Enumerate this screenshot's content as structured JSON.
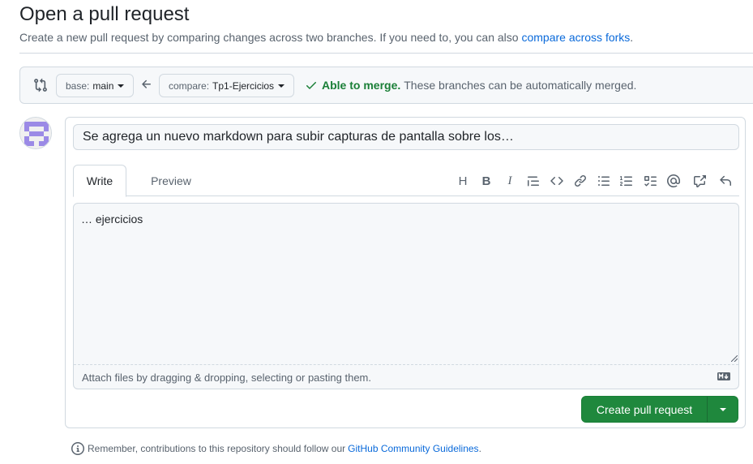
{
  "header": {
    "title": "Open a pull request",
    "subtitle_text": "Create a new pull request by comparing changes across two branches. If you need to, you can also",
    "subtitle_link": "compare across forks",
    "subtitle_end": "."
  },
  "compare": {
    "base_prefix": "base:",
    "base_value": "main",
    "compare_prefix": "compare:",
    "compare_value": "Tp1-Ejercicios",
    "merge_status": "Able to merge.",
    "merge_detail": "These branches can be automatically merged."
  },
  "form": {
    "title_value": "Se agrega un nuevo markdown para subir capturas de pantalla sobre los…",
    "tabs": {
      "write": "Write",
      "preview": "Preview"
    },
    "body_value": "… ejercicios",
    "attach_hint": "Attach files by dragging & dropping, selecting or pasting them.",
    "create_label": "Create pull request"
  },
  "toolbar": {
    "heading": "H",
    "bold": "B",
    "italic": "I"
  },
  "footer": {
    "text": "Remember, contributions to this repository should follow our",
    "link": "GitHub Community Guidelines",
    "end": "."
  },
  "colors": {
    "link": "#0969da",
    "success": "#1a7f37",
    "primary_button": "#1f883d",
    "avatar": "#9b8ae6"
  }
}
